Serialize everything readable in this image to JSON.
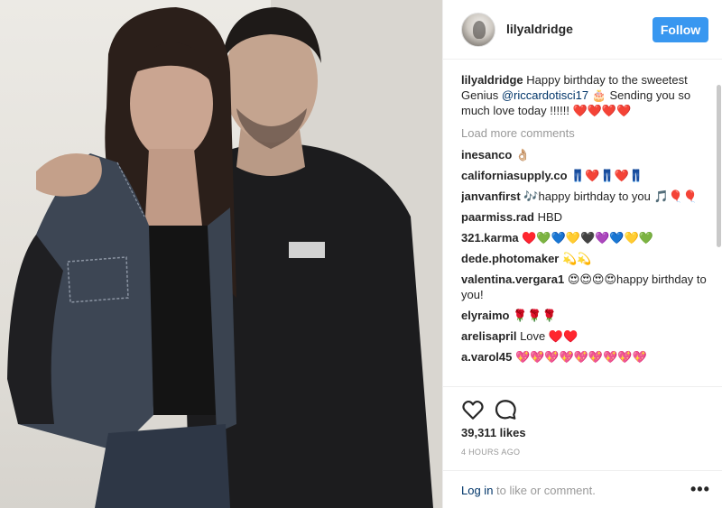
{
  "post": {
    "username": "lilyaldridge",
    "follow_label": "Follow",
    "caption": {
      "username": "lilyaldridge",
      "text_before": "Happy birthday to the sweetest Genius ",
      "mention": "@riccardotisci17",
      "text_after": " 🎂 Sending you so much love today !!!!!! ❤️❤️❤️❤️"
    },
    "load_more_label": "Load more comments",
    "comments": [
      {
        "username": "inesanco",
        "text": "👌🏼"
      },
      {
        "username": "californiasupply.co",
        "text": "👖❤️👖❤️👖"
      },
      {
        "username": "janvanfirst",
        "text": "🎶happy birthday to you 🎵🎈🎈"
      },
      {
        "username": "paarmiss.rad",
        "text": "HBD"
      },
      {
        "username": "321.karma",
        "text": "♥️💚💙💛🖤💜💙💛💚"
      },
      {
        "username": "dede.photomaker",
        "text": "💫💫"
      },
      {
        "username": "valentina.vergara1",
        "text": "😍😍😍😍happy birthday to you!"
      },
      {
        "username": "elyraimo",
        "text": "🌹🌹🌹"
      },
      {
        "username": "arelisapril",
        "text": "Love ♥️♥️"
      },
      {
        "username": "a.varol45",
        "text": "💖💖💖💖💖💖💖💖💖"
      }
    ],
    "likes": "39,311 likes",
    "time": "4 HOURS AGO",
    "login_link": "Log in",
    "login_text": " to like or comment.",
    "more_label": "•••",
    "icons": [
      "heart-icon",
      "comment-icon",
      "more-options-icon"
    ]
  }
}
